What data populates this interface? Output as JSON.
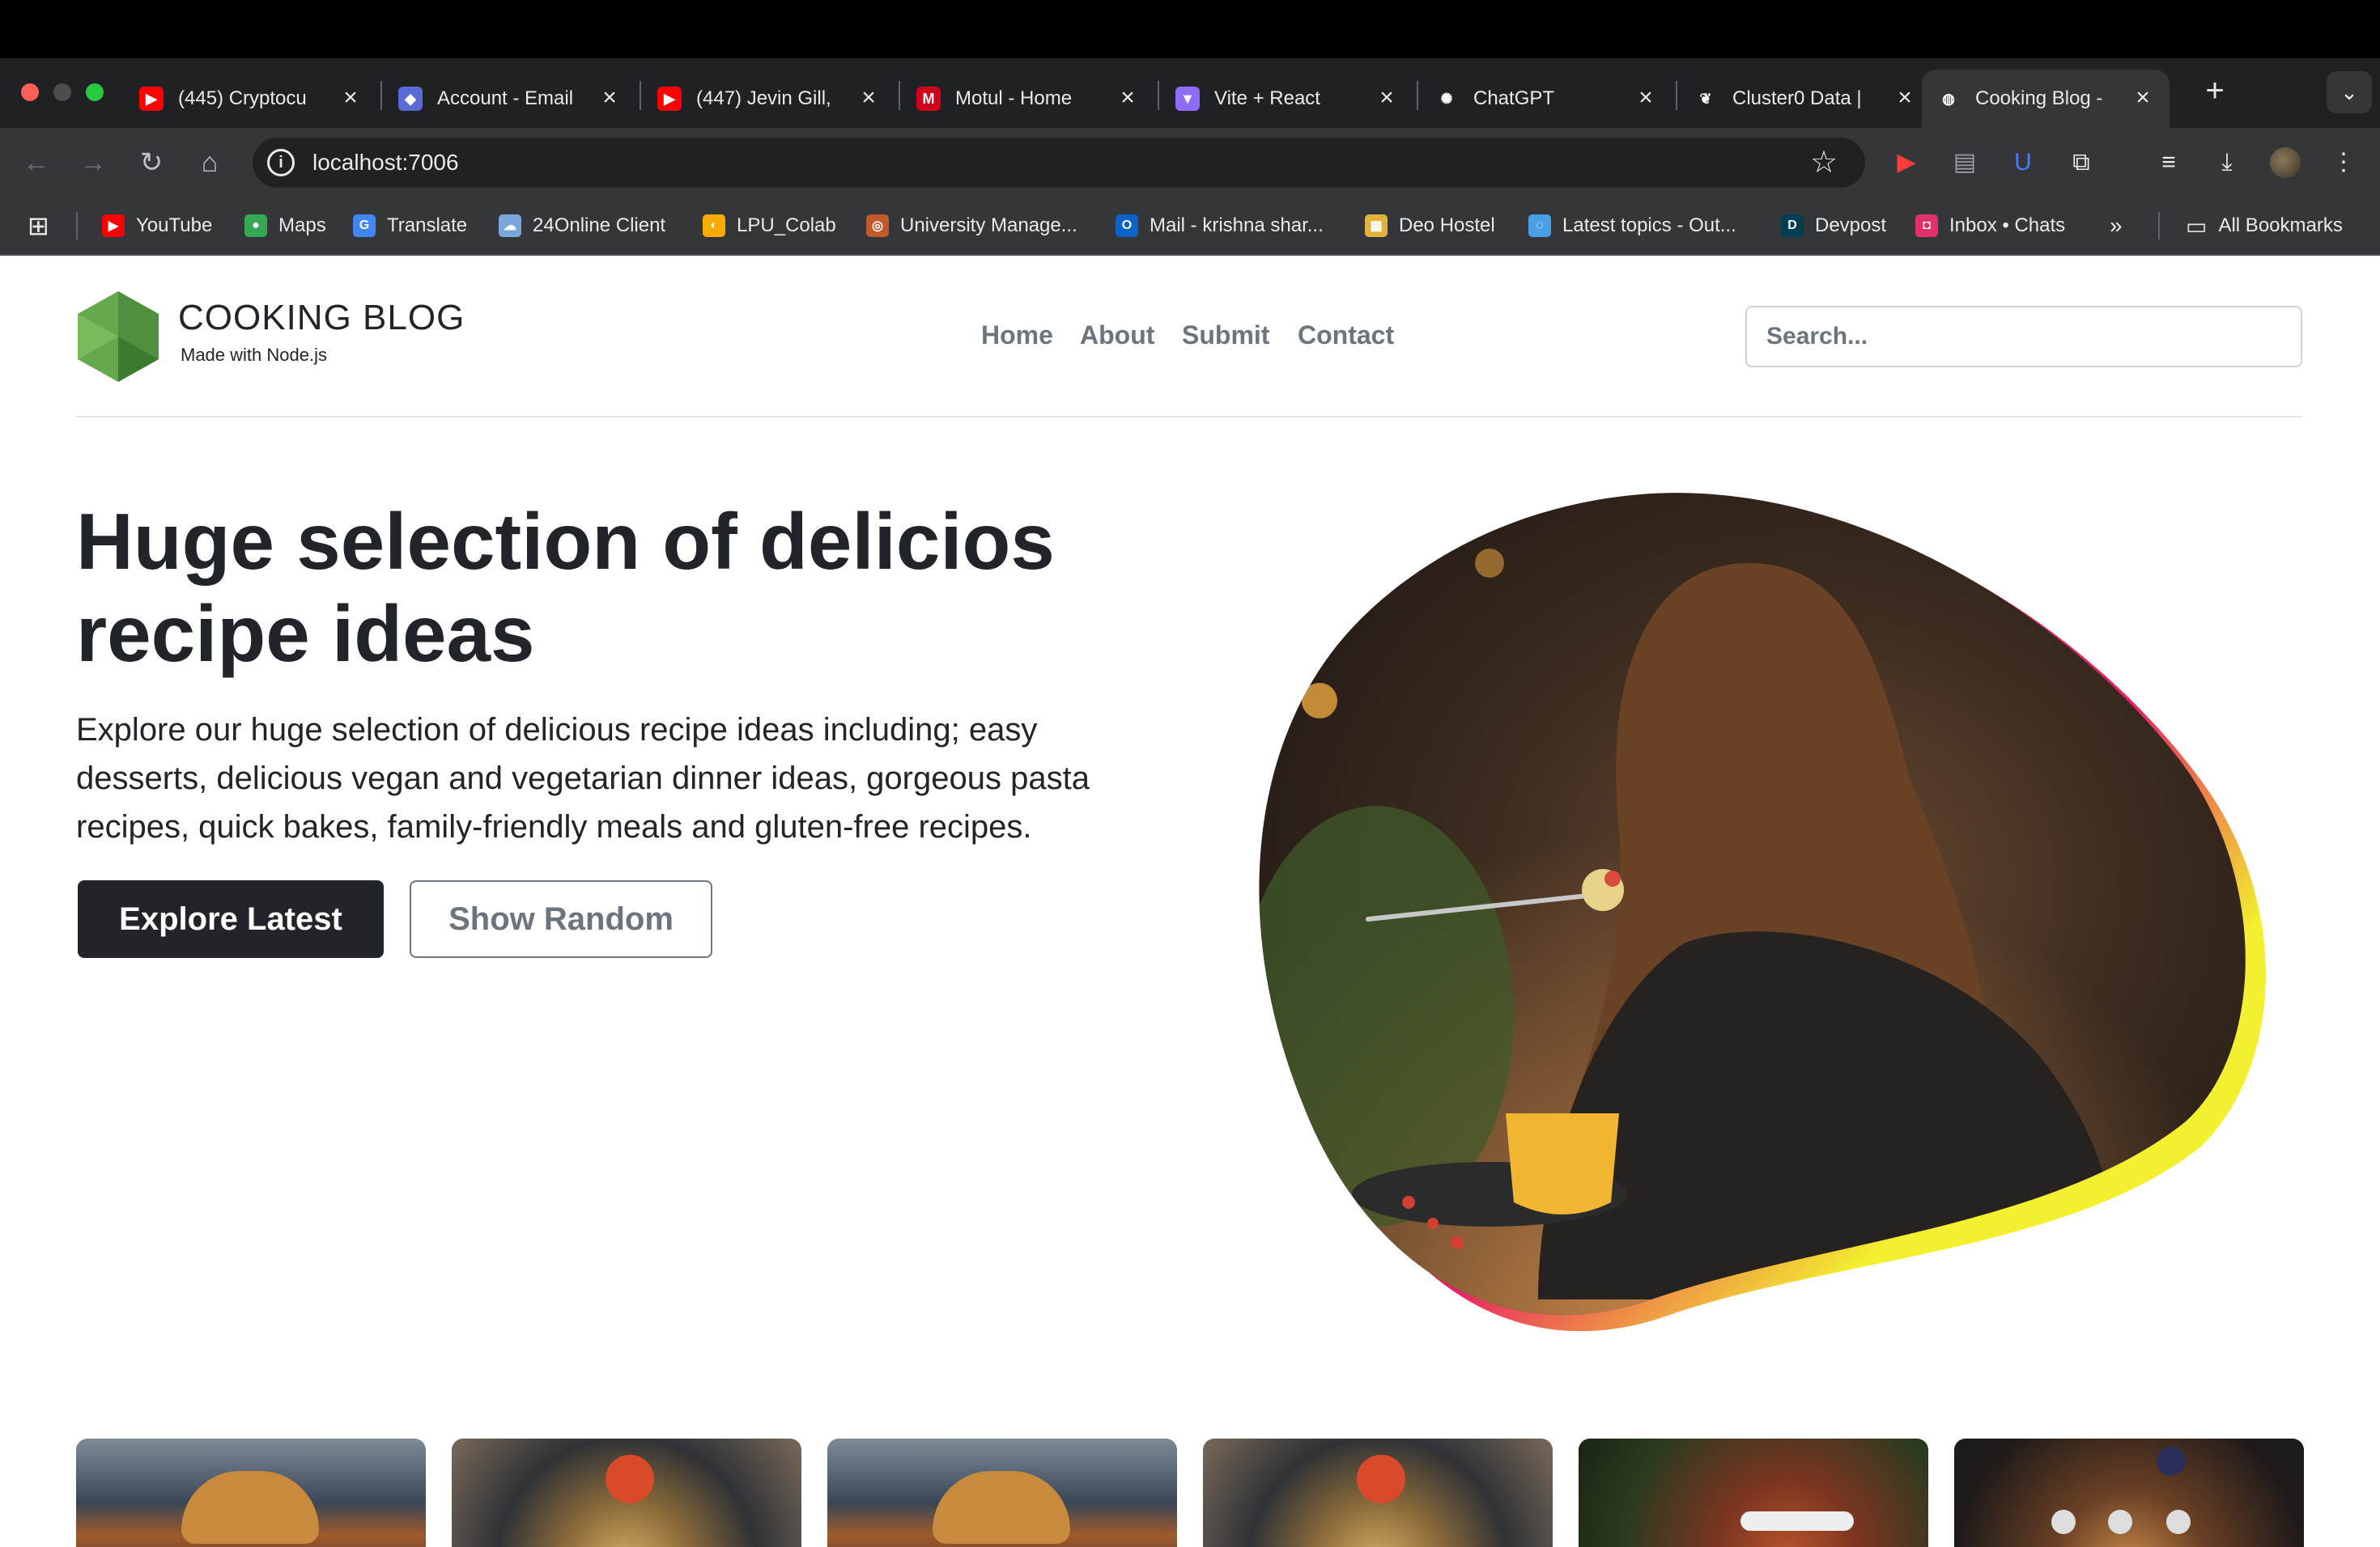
{
  "browser": {
    "tabs": [
      {
        "title": "(445) Cryptocu",
        "favicon": "youtube-icon",
        "color": "#ff0000",
        "glyph": "▶"
      },
      {
        "title": "Account - Email",
        "favicon": "account-icon",
        "color": "#5b6bd6",
        "glyph": "◆"
      },
      {
        "title": "(447) Jevin Gill,",
        "favicon": "youtube-icon",
        "color": "#ff0000",
        "glyph": "▶"
      },
      {
        "title": "Motul - Home",
        "favicon": "motul-icon",
        "color": "#d0021b",
        "glyph": "M"
      },
      {
        "title": "Vite + React",
        "favicon": "vite-icon",
        "color": "#8e6cf5",
        "glyph": "▼"
      },
      {
        "title": "ChatGPT",
        "favicon": "chatgpt-icon",
        "color": "#202124",
        "glyph": "✺"
      },
      {
        "title": "Cluster0 Data |",
        "favicon": "mongodb-leaf-icon",
        "color": "#202124",
        "glyph": "❦"
      },
      {
        "title": "Cooking Blog -",
        "favicon": "globe-icon",
        "color": "#35363a",
        "glyph": "◍"
      }
    ],
    "close_glyph": "×",
    "new_tab_glyph": "+",
    "tab_menu_glyph": "⌄",
    "url": "localhost:7006",
    "bookmarks": [
      {
        "label": "YouTube",
        "icon": "youtube-icon",
        "color": "#ff0000",
        "glyph": "▶"
      },
      {
        "label": "Maps",
        "icon": "maps-pin-icon",
        "color": "#34a853",
        "glyph": "●"
      },
      {
        "label": "Translate",
        "icon": "translate-icon",
        "color": "#4285f4",
        "glyph": "G"
      },
      {
        "label": "24Online Client",
        "icon": "cloud-icon",
        "color": "#7aa7d9",
        "glyph": "☁"
      },
      {
        "label": "LPU_Colab",
        "icon": "colab-icon",
        "color": "#f9ab00",
        "glyph": "◐"
      },
      {
        "label": "University Manage...",
        "icon": "university-icon",
        "color": "#c05a2b",
        "glyph": "◎"
      },
      {
        "label": "Mail - krishna shar...",
        "icon": "outlook-icon",
        "color": "#0a64c8",
        "glyph": "O"
      },
      {
        "label": "Deo Hostel",
        "icon": "book-icon",
        "color": "#e2b33b",
        "glyph": "▦"
      },
      {
        "label": "Latest topics - Out...",
        "icon": "discourse-icon",
        "color": "#4aa0e6",
        "glyph": "◌"
      },
      {
        "label": "Devpost",
        "icon": "devpost-icon",
        "color": "#003e54",
        "glyph": "D"
      },
      {
        "label": "Inbox • Chats",
        "icon": "instagram-icon",
        "color": "#e1306c",
        "glyph": "◘"
      }
    ],
    "more_bookmarks": "»",
    "all_bookmarks": "All Bookmarks"
  },
  "site": {
    "brand": "COOKING BLOG",
    "tagline": "Made with Node.js",
    "nav": [
      "Home",
      "About",
      "Submit",
      "Contact"
    ],
    "search_placeholder": "Search..."
  },
  "hero": {
    "title": "Huge selection of delicios recipe ideas",
    "text": "Explore our huge selection of delicious recipe ideas including; easy desserts, delicious vegan and vegetarian dinner ideas, gorgeous pasta recipes, quick bakes, family-friendly meals and gluten-free recipes.",
    "primary_button": "Explore Latest",
    "secondary_button": "Show Random"
  },
  "colors": {
    "accent_pink": "#e91e63",
    "accent_yellow": "#f3f02f",
    "dark": "#212529",
    "muted": "#6c757d"
  }
}
